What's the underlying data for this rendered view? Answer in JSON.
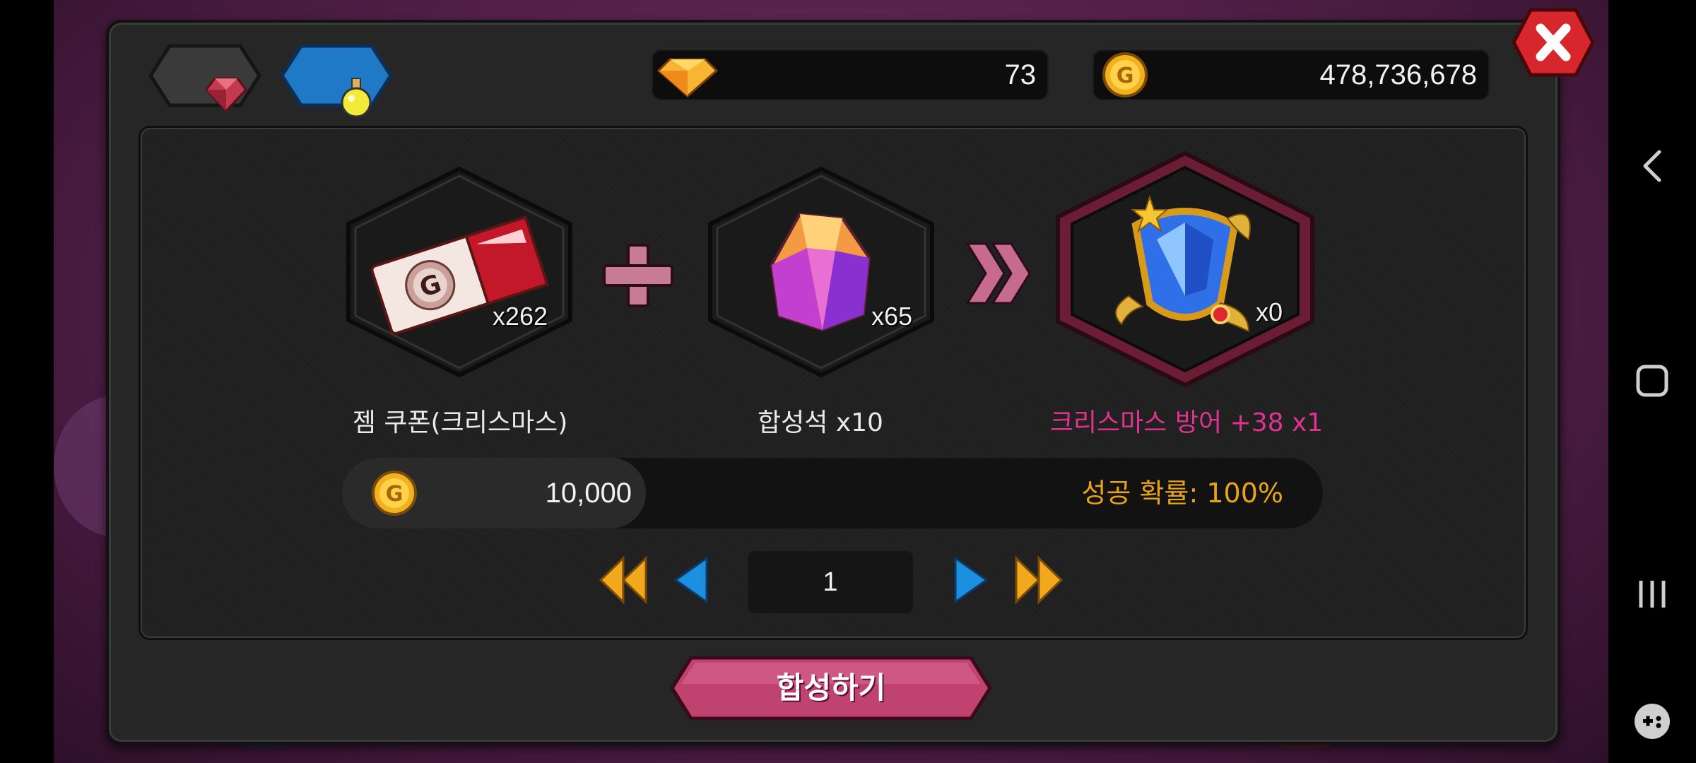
{
  "tabs": [
    {
      "name": "gem-tab",
      "icon": "red-gem-icon",
      "active": false
    },
    {
      "name": "potion-tab",
      "icon": "yellow-potion-icon",
      "active": true
    }
  ],
  "currency": {
    "diamonds": "73",
    "gold": "478,736,678",
    "diamond_icon": "diamond-icon",
    "gold_icon": "gold-coin-icon"
  },
  "recipe": {
    "ingredient1": {
      "label": "젬 쿠폰(크리스마스)",
      "quantity": "x262",
      "icon": "gold-coupon-icon"
    },
    "ingredient2": {
      "label": "합성석 x10",
      "quantity": "x65",
      "icon": "synthesis-stone-icon"
    },
    "result": {
      "label": "크리스마스 방어 +38 x1",
      "quantity": "x0",
      "icon": "christmas-defense-gem-icon"
    }
  },
  "cost": {
    "value": "10,000",
    "icon": "gold-coin-icon"
  },
  "success_rate": "성공 확률: 100%",
  "pager": {
    "page": "1"
  },
  "synthesize_button": "합성하기",
  "colors": {
    "accent_pink": "#e0338f",
    "gold_text": "#e8a317",
    "button_pink": "#c0426f",
    "pager_orange": "#f2a81d",
    "pager_blue": "#1d8fe0"
  }
}
